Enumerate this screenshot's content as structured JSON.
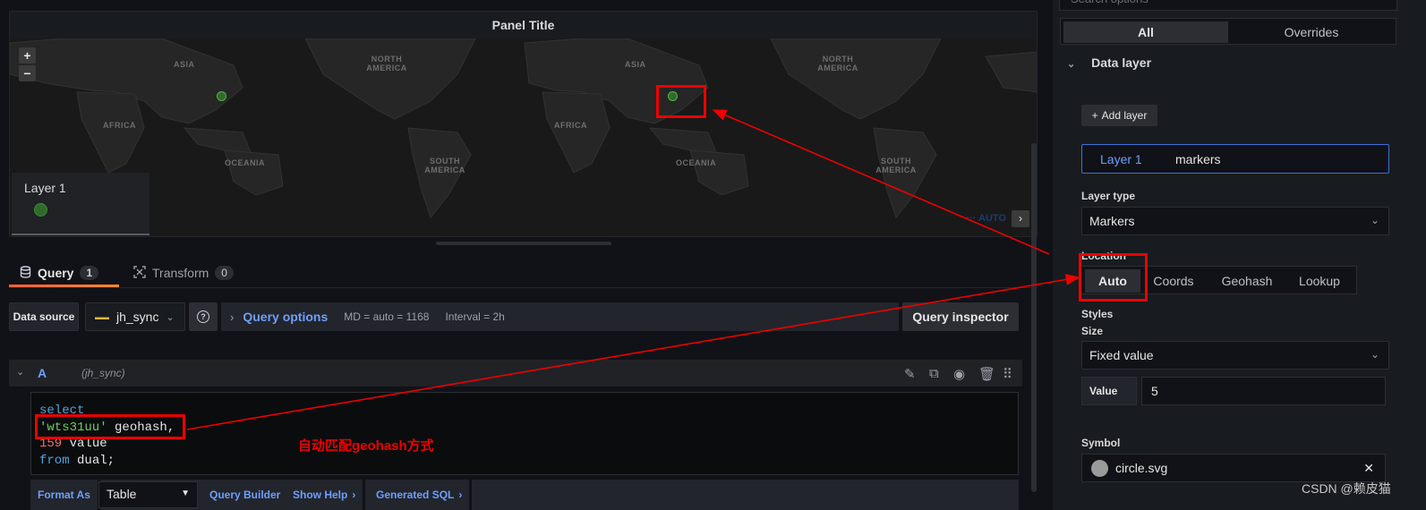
{
  "panel": {
    "title": "Panel Title"
  },
  "map": {
    "labels": [
      "ASIA",
      "NORTH\nAMERICA",
      "AFRICA",
      "OCEANIA",
      "SOUTH\nAMERICA"
    ],
    "zoom_in": "+",
    "zoom_out": "−",
    "scale_text": "··· AUTO",
    "next": "›"
  },
  "legend": {
    "title": "Layer 1"
  },
  "tabs": [
    {
      "label": "Query",
      "count": "1"
    },
    {
      "label": "Transform",
      "count": "0"
    }
  ],
  "query_row": {
    "ds_label": "Data source",
    "ds_value": "jh_sync",
    "options_label": "Query options",
    "md": "MD = auto = 1168",
    "interval": "Interval = 2h",
    "inspector": "Query inspector"
  },
  "query": {
    "ref": "A",
    "ds": "(jh_sync)",
    "sql": {
      "l1": "select",
      "l2_str": "'wts31uu'",
      "l2_rest": " geohash,",
      "l3_num": "159",
      "l3_rest": " value",
      "l4_kw": "from",
      "l4_rest": " dual;"
    }
  },
  "footer": {
    "format_as": "Format As",
    "format_value": "Table",
    "query_builder": "Query Builder",
    "show_help": "Show Help",
    "generated_sql": "Generated SQL"
  },
  "options": {
    "search_placeholder": "Search options",
    "all": "All",
    "overrides": "Overrides",
    "data_layer": "Data layer",
    "add_layer": "Add layer",
    "layer_name": "Layer 1",
    "layer_kind": "markers",
    "layer_type_label": "Layer type",
    "layer_type_value": "Markers",
    "location_label": "Location",
    "location_options": [
      "Auto",
      "Coords",
      "Geohash",
      "Lookup"
    ],
    "styles": "Styles",
    "size": "Size",
    "size_value": "Fixed value",
    "value_label": "Value",
    "value": "5",
    "symbol_label": "Symbol",
    "symbol_value": "circle.svg"
  },
  "annotation": "自动匹配geohash方式",
  "watermark": "CSDN @赖皮猫"
}
